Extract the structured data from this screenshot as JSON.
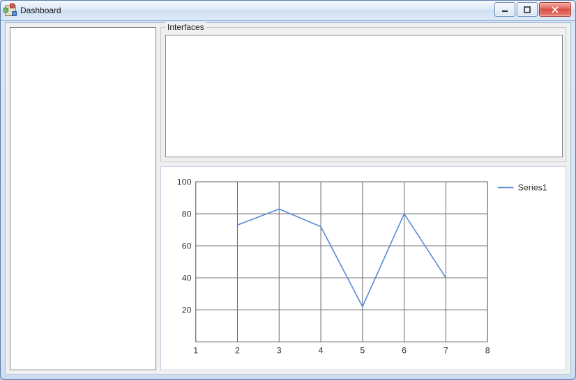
{
  "window": {
    "title": "Dashboard",
    "buttons": {
      "min_name": "minimize",
      "max_name": "maximize",
      "close_name": "close"
    }
  },
  "interfaces": {
    "group_label": "Interfaces"
  },
  "chart_data": {
    "type": "line",
    "series": [
      {
        "name": "Series1",
        "x": [
          2,
          3,
          4,
          5,
          6,
          7
        ],
        "values": [
          73,
          83,
          72,
          22,
          80,
          40
        ]
      }
    ],
    "xlim": [
      1,
      8
    ],
    "ylim": [
      0,
      100
    ],
    "xticks": [
      1,
      2,
      3,
      4,
      5,
      6,
      7,
      8
    ],
    "yticks": [
      20,
      40,
      60,
      80,
      100
    ],
    "xlabel": "",
    "ylabel": "",
    "title": "",
    "legend_position": "right",
    "line_color": "#5b8dd6"
  }
}
